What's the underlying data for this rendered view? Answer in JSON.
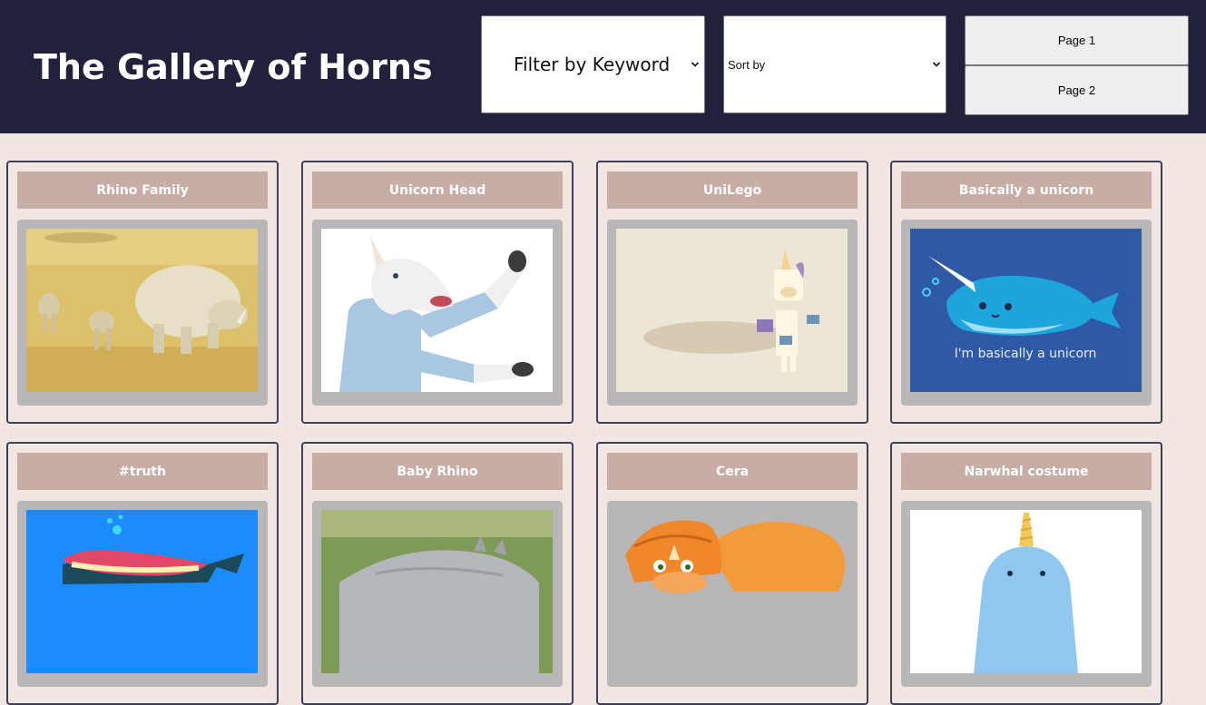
{
  "header": {
    "title": "The Gallery of Horns",
    "filter_select": {
      "selected": "Filter by Keyword"
    },
    "sort_select": {
      "selected": "Sort by"
    },
    "pages": [
      "Page 1",
      "Page 2"
    ]
  },
  "gallery": {
    "cards": [
      {
        "title": "Rhino Family",
        "image": "rhino-family-photo"
      },
      {
        "title": "Unicorn Head",
        "image": "unicorn-head-photo"
      },
      {
        "title": "UniLego",
        "image": "unilego-photo"
      },
      {
        "title": "Basically a unicorn",
        "image": "narwhal-illustration",
        "image_caption": "I'm basically a unicorn"
      },
      {
        "title": "#truth",
        "image": "truth-illustration"
      },
      {
        "title": "Baby Rhino",
        "image": "baby-rhino-photo"
      },
      {
        "title": "Cera",
        "image": "cera-dinosaur-illustration"
      },
      {
        "title": "Narwhal costume",
        "image": "narwhal-costume-photo"
      }
    ]
  },
  "colors": {
    "header_bg": "#21213c",
    "page_bg": "#f1e6e2",
    "card_title_bg": "#c8aca6",
    "card_border": "#3e3e5c",
    "image_frame": "#b8b6b6"
  }
}
